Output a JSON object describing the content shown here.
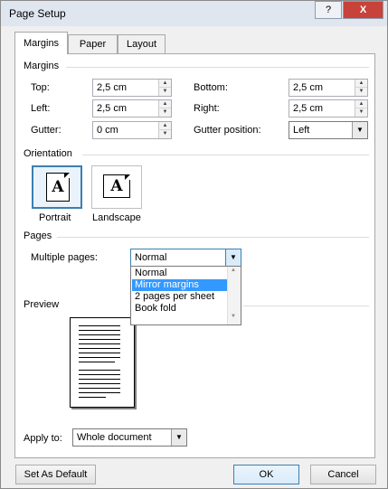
{
  "window": {
    "title": "Page Setup",
    "help_label": "?",
    "close_label": "X"
  },
  "tabs": [
    {
      "label": "Margins",
      "active": true
    },
    {
      "label": "Paper",
      "active": false
    },
    {
      "label": "Layout",
      "active": false
    }
  ],
  "margins": {
    "heading": "Margins",
    "top": {
      "label": "Top:",
      "value": "2,5 cm"
    },
    "bottom": {
      "label": "Bottom:",
      "value": "2,5 cm"
    },
    "left": {
      "label": "Left:",
      "value": "2,5 cm"
    },
    "right": {
      "label": "Right:",
      "value": "2,5 cm"
    },
    "gutter": {
      "label": "Gutter:",
      "value": "0 cm"
    },
    "gutter_position": {
      "label": "Gutter position:",
      "value": "Left"
    }
  },
  "orientation": {
    "heading": "Orientation",
    "portrait_label": "Portrait",
    "landscape_label": "Landscape",
    "icon_letter": "A",
    "selected": "portrait"
  },
  "pages": {
    "heading": "Pages",
    "multiple_pages_label": "Multiple pages:",
    "selected": "Normal",
    "options": [
      "Normal",
      "Mirror margins",
      "2 pages per sheet",
      "Book fold"
    ],
    "highlighted_index": 1
  },
  "preview": {
    "heading": "Preview"
  },
  "apply_to": {
    "label": "Apply to:",
    "value": "Whole document"
  },
  "buttons": {
    "set_as_default": "Set As Default",
    "ok": "OK",
    "cancel": "Cancel"
  },
  "colors": {
    "accent": "#3c7fb1",
    "highlight": "#3399ff",
    "close_button": "#c7433a"
  }
}
